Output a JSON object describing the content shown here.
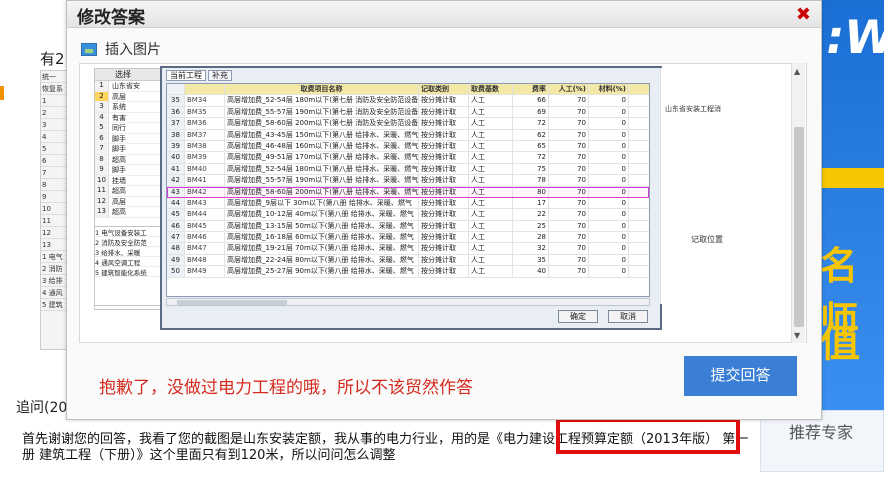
{
  "background": {
    "heading_fragment": "有2",
    "append_question_label": "追问(20",
    "followup_text": "首先谢谢您的回答，我看了您的截图是山东安装定额，我从事的电力行业，用的是《电力建设工程预算定额（2013年版） 第一册 建筑工程（下册）》这个里面只有到120米，所以问问怎么调整",
    "side_panel_title": "推荐专家",
    "brand_color": "#3a7fd5"
  },
  "dialog": {
    "title": "修改答案",
    "close_icon": "close-icon",
    "insert_image_label": "插入图片",
    "answer_text": "抱歉了，没做过电力工程的哦，所以不该贸然作答",
    "answer_color": "#d42a1e",
    "submit_label": "提交回答"
  },
  "screenshot": {
    "select_label": "选择",
    "tree_rows": [
      {
        "n": "1",
        "t": "山东省安"
      },
      {
        "n": "2",
        "t": "高层"
      },
      {
        "n": "3",
        "t": "系统"
      },
      {
        "n": "4",
        "t": "有害"
      },
      {
        "n": "5",
        "t": "同行"
      },
      {
        "n": "6",
        "t": "脚手"
      },
      {
        "n": "7",
        "t": "脚手"
      },
      {
        "n": "8",
        "t": "超高"
      },
      {
        "n": "9",
        "t": "脚手"
      },
      {
        "n": "10",
        "t": "挂墙"
      },
      {
        "n": "11",
        "t": "超高"
      },
      {
        "n": "12",
        "t": "高层"
      },
      {
        "n": "13",
        "t": "超高"
      }
    ],
    "tabs": [
      "当前工程",
      "补充"
    ],
    "headers": [
      "",
      "",
      "取费项目名称",
      "记取类别",
      "取费基数",
      "费率",
      "人工(%)",
      "材料(%)"
    ],
    "rows": [
      [
        "35",
        "BM34",
        "高层增加费_52-54层 180m以下(第七册 消防及安全防范设备",
        "按分摊计取",
        "人工",
        "66",
        "70",
        "0"
      ],
      [
        "36",
        "BM35",
        "高层增加费_55-57层 190m以下(第七册 消防及安全防范设备",
        "按分摊计取",
        "人工",
        "69",
        "70",
        "0"
      ],
      [
        "37",
        "BM36",
        "高层增加费_58-60层 200m以下(第七册 消防及安全防范设备",
        "按分摊计取",
        "人工",
        "72",
        "70",
        "0"
      ],
      [
        "38",
        "BM37",
        "高层增加费_43-45层 150m以下(第八册 给排水、采暖、燃气",
        "按分摊计取",
        "人工",
        "62",
        "70",
        "0"
      ],
      [
        "39",
        "BM38",
        "高层增加费_46-48层 160m以下(第八册 给排水、采暖、燃气",
        "按分摊计取",
        "人工",
        "65",
        "70",
        "0"
      ],
      [
        "40",
        "BM39",
        "高层增加费_49-51层 170m以下(第八册 给排水、采暖、燃气",
        "按分摊计取",
        "人工",
        "72",
        "70",
        "0"
      ],
      [
        "41",
        "BM40",
        "高层增加费_52-54层 180m以下(第八册 给排水、采暖、燃气",
        "按分摊计取",
        "人工",
        "75",
        "70",
        "0"
      ],
      [
        "42",
        "BM41",
        "高层增加费_55-57层 190m以下(第八册 给排水、采暖、燃气",
        "按分摊计取",
        "人工",
        "78",
        "70",
        "0"
      ],
      [
        "43",
        "BM42",
        "高层增加费_58-60层 200m以下(第八册 给排水、采暖、燃气",
        "按分摊计取",
        "人工",
        "80",
        "70",
        "0"
      ],
      [
        "44",
        "BM43",
        "高层增加费_9层以下 30m以下(第八册 给排水、采暖、燃气",
        "按分摊计取",
        "人工",
        "17",
        "70",
        "0"
      ],
      [
        "45",
        "BM44",
        "高层增加费_10-12层 40m以下(第八册 给排水、采暖、燃气",
        "按分摊计取",
        "人工",
        "22",
        "70",
        "0"
      ],
      [
        "46",
        "BM45",
        "高层增加费_13-15层 50m以下(第八册 给排水、采暖、燃气",
        "按分摊计取",
        "人工",
        "25",
        "70",
        "0"
      ],
      [
        "47",
        "BM46",
        "高层增加费_16-18层 60m以下(第八册 给排水、采暖、燃气",
        "按分摊计取",
        "人工",
        "28",
        "70",
        "0"
      ],
      [
        "48",
        "BM47",
        "高层增加费_19-21层 70m以下(第八册 给排水、采暖、燃气",
        "按分摊计取",
        "人工",
        "32",
        "70",
        "0"
      ],
      [
        "49",
        "BM48",
        "高层增加费_22-24层 80m以下(第八册 给排水、采暖、燃气",
        "按分摊计取",
        "人工",
        "35",
        "70",
        "0"
      ],
      [
        "50",
        "BM49",
        "高层增加费_25-27层 90m以下(第八册 给排水、采暖、燃气",
        "按分摊计取",
        "人工",
        "40",
        "70",
        "0"
      ]
    ],
    "ok_label": "确定",
    "cancel_label": "取消",
    "right_text": "山东省安装工程消",
    "right_col_label": "记取位置",
    "bottom_rows": [
      "1 电气设备安装工",
      "2 消防及安全防范",
      "3 给排水、采暖",
      "4 通风空调工程",
      "5 建筑智能化系统"
    ]
  }
}
